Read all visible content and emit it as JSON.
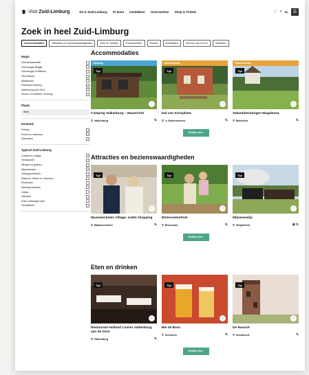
{
  "header": {
    "logo_prefix": "Visit",
    "logo_name": "Zuid-Limburg",
    "nav": [
      "Dit is Zuid-Limburg",
      "Te doen",
      "Ontdekken",
      "Overnachten",
      "Shop & Tickets"
    ],
    "lang": "NL"
  },
  "page_title": "Zoek in heel Zuid-Limburg",
  "chips": [
    "Accommodaties",
    "Attracties en bezienswaardigheden",
    "Eten en drinken",
    "Evenementen",
    "Routes",
    "Activiteiten",
    "Vervoer van A tot Z",
    "Winkelen"
  ],
  "sidebar": {
    "regio_title": "Regio",
    "regio": [
      "Grensmaasvallei",
      "Grensregio België",
      "Grensregio Duitsland",
      "Heuvelland",
      "Maastricht",
      "Parkstad Limburg",
      "Valkenburg a/d Geul",
      "Noord- en Midden Limburg"
    ],
    "plaats_title": "Plaats",
    "plaats_value": "Alles",
    "kenmerk_title": "Kenmerk",
    "kenmerk": [
      "Fietsen",
      "Kuren en wellness",
      "Wandelen"
    ],
    "typisch_title": "Typisch Zuid-Limburg",
    "typisch": [
      "Cultuur en religie",
      "Heelkproef",
      "Mergel en grotten",
      "Mijnverleden",
      "Oorlogsverleden",
      "Rivieren, beken en bronnen",
      "Romeinen",
      "Streekproducten",
      "Urban",
      "Vakwerk",
      "Zuid-Limburgse wijn",
      "Heimakerie"
    ]
  },
  "sections": [
    {
      "title": "Accommodaties",
      "button": "Bekijk alles",
      "cards": [
        {
          "band": "Camping",
          "band_color": "#4aa5d6",
          "tip": "Tip!",
          "title": "Camping Valkenburg – Maastricht",
          "place": "Valkenburg",
          "icons": "⛐"
        },
        {
          "band": "Vakantiehuisje",
          "band_color": "#e8a33a",
          "tip": "Tip!",
          "title": "Dal van Schophem",
          "place": "'s Gravenvoeren",
          "icons": "⛐"
        },
        {
          "band": "Vakantiehuisje",
          "band_color": "#e8a33a",
          "tip": "Tip!",
          "title": "Vakantiewoningen Magalenas",
          "place": "Mechelen",
          "icons": "⛐"
        }
      ]
    },
    {
      "title": "Attracties en bezienswaardigheden",
      "button": "Bekijk alles",
      "cards": [
        {
          "tip": "Tip!",
          "title": "Maasmechelen Village, outlet shopping",
          "place": "Maasmechelen",
          "icons": "⛐"
        },
        {
          "tip": "Tip!",
          "title": "BlotevoetenPark",
          "place": "Brunssum",
          "icons": "⛐"
        },
        {
          "tip": "Tip!",
          "title": "Miljoenenlijn",
          "place": "Simpelveld",
          "icons": "▣ ⛐"
        }
      ]
    },
    {
      "title": "Eten en drinken",
      "button": "Bekijk alles",
      "cards": [
        {
          "tip": "Tip!",
          "title": "Restaurant Holland Casino Valkenburg aan de Geul",
          "place": "Valkenburg",
          "icons": "⛐"
        },
        {
          "tip": "Tip!",
          "title": "Bie de Bron",
          "place": "Schinnen",
          "icons": "⛐"
        },
        {
          "tip": "Tip!",
          "title": "De Rausch",
          "place": "Schimmert",
          "icons": "⛐"
        }
      ]
    }
  ]
}
